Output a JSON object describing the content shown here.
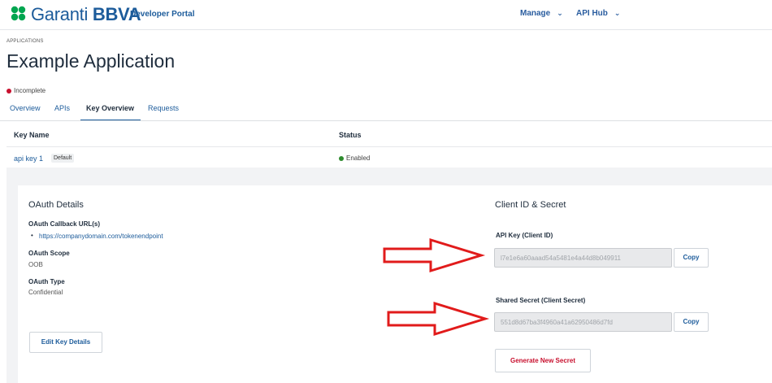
{
  "header": {
    "brand": "Garanti BBVA",
    "brand_part1": "Garanti",
    "brand_part2": "BBVA",
    "portal": "Developer Portal",
    "nav": [
      {
        "label": "Manage"
      },
      {
        "label": "API Hub"
      }
    ],
    "logo_color": "#00a650",
    "icon": "chevron-down-icon"
  },
  "page": {
    "breadcrumb": "APPLICATIONS",
    "title": "Example Application",
    "status": "Incomplete",
    "status_color": "#c8102e"
  },
  "tabs": [
    {
      "label": "Overview",
      "active": false
    },
    {
      "label": "APIs",
      "active": false
    },
    {
      "label": "Key Overview",
      "active": true
    },
    {
      "label": "Requests",
      "active": false
    }
  ],
  "keys_table": {
    "headers": [
      "Key Name",
      "Status"
    ],
    "rows": [
      {
        "name": "api key 1",
        "badge": "Default",
        "status": "Enabled",
        "status_color": "#2e8b2e"
      }
    ]
  },
  "oauth": {
    "title": "OAuth Details",
    "callback_label": "OAuth Callback URL(s)",
    "callback_url": "https://companydomain.com/tokenendpoint",
    "scope_label": "OAuth Scope",
    "scope_value": "OOB",
    "type_label": "OAuth Type",
    "type_value": "Confidential",
    "edit_button": "Edit Key Details"
  },
  "client": {
    "title": "Client ID & Secret",
    "api_key_label": "API Key (Client ID)",
    "api_key_value": "l7e1e6a60aaad54a5481e4a44d8b049911",
    "copy_label": "Copy",
    "secret_label": "Shared Secret (Client Secret)",
    "secret_value": "551d8d67ba3f4960a41a62950486d7fd",
    "generate_button": "Generate New Secret",
    "accent_color": "#c8102e"
  },
  "annotation_color": "#e11b1b"
}
